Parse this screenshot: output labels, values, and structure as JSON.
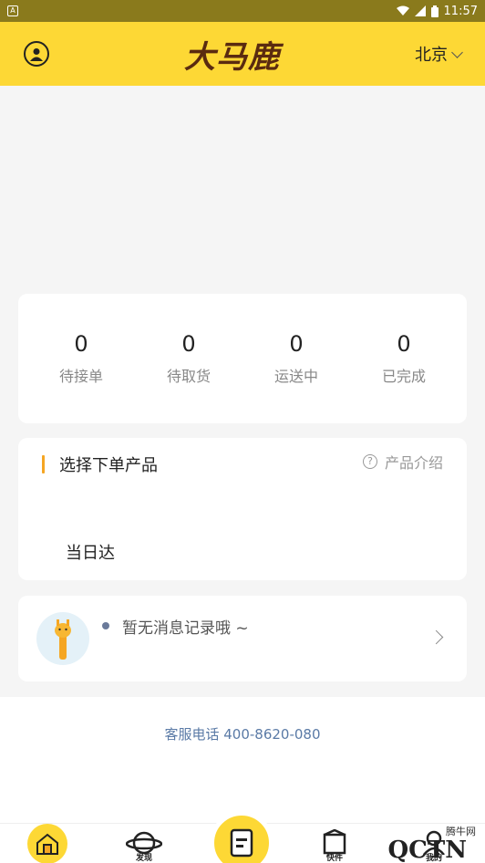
{
  "status_bar": {
    "time": "11:57",
    "battery": "▮"
  },
  "header": {
    "logo": "大马鹿",
    "city": "北京"
  },
  "stats": [
    {
      "value": "0",
      "label": "待接单"
    },
    {
      "value": "0",
      "label": "待取货"
    },
    {
      "value": "0",
      "label": "运送中"
    },
    {
      "value": "0",
      "label": "已完成"
    }
  ],
  "product": {
    "title": "选择下单产品",
    "intro_link": "产品介绍",
    "help_glyph": "?",
    "items": [
      "当日达"
    ]
  },
  "message": {
    "text": "暂无消息记录哦 ~"
  },
  "footer": {
    "service_phone": "客服电话 400-8620-080"
  },
  "bottom_nav": {
    "items": [
      {
        "label": ""
      },
      {
        "label": "发现"
      },
      {
        "label": ""
      },
      {
        "label": "快件"
      },
      {
        "label": "我的"
      }
    ]
  },
  "watermark": {
    "text": "腾牛网",
    "logo": "QCTN"
  },
  "colors": {
    "brand_yellow": "#fdd835",
    "accent_orange": "#f5a623",
    "link_blue": "#5a7aa6"
  },
  "icons": [
    "avatar-icon",
    "chevron-down-icon",
    "help-icon",
    "giraffe-icon",
    "chevron-right-icon",
    "home-icon",
    "planet-icon",
    "order-icon",
    "package-icon",
    "user-icon"
  ]
}
